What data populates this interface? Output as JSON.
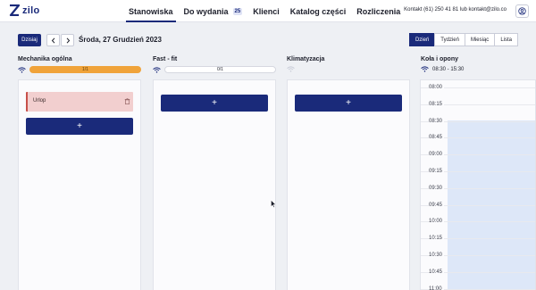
{
  "app": {
    "logo_text": "zilo"
  },
  "nav": {
    "items": [
      {
        "label": "Stanowiska",
        "active": true
      },
      {
        "label": "Do wydania",
        "badge": "25"
      },
      {
        "label": "Klienci"
      },
      {
        "label": "Katalog części"
      },
      {
        "label": "Rozliczenia"
      }
    ],
    "contact": "Kontakt (61) 250 41 81 lub kontakt@zilo.co"
  },
  "toolbar": {
    "today_label": "Dzisiaj",
    "date_label": "Środa, 27 Grudzień 2023",
    "views": [
      "Dzień",
      "Tydzień",
      "Miesiąc",
      "Lista"
    ],
    "active_view": "Dzień"
  },
  "columns": [
    {
      "title": "Mechanika ogólna",
      "status": "online",
      "progress": "1/1",
      "progress_fraction": 1.0,
      "event": {
        "label": "Urlop"
      },
      "add_label": "+"
    },
    {
      "title": "Fast - fit",
      "status": "online",
      "progress": "0/1",
      "progress_fraction": 0.0,
      "add_label": "+"
    },
    {
      "title": "Klimatyzacja",
      "status": "offline",
      "add_label": "+"
    },
    {
      "title": "Koła i opony",
      "status": "online",
      "hours": "08:30 - 15:30",
      "times": [
        "08:00",
        "08:15",
        "08:30",
        "08:45",
        "09:00",
        "09:15",
        "09:30",
        "09:45",
        "10:00",
        "10:15",
        "10:30",
        "10:45",
        "11:00"
      ]
    }
  ],
  "colors": {
    "primary": "#1a2a7a",
    "progress_full": "#f0a33a",
    "event_bg": "#f2cfcf",
    "event_border": "#c7504a",
    "slot_bg": "#dde7f8"
  }
}
